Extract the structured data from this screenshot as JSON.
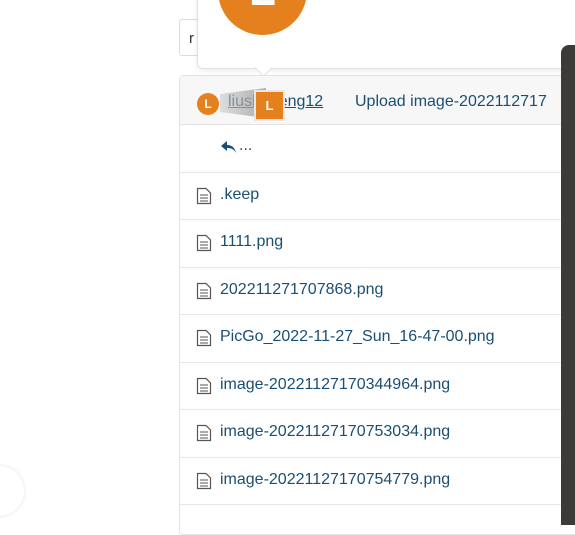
{
  "popup": {
    "avatar_letter": "L"
  },
  "search": {
    "value": "r"
  },
  "commit": {
    "avatar_letter": "L",
    "drag_avatar_letter": "L",
    "author": "liushuheng12",
    "message": "Upload image-2022112717"
  },
  "files": {
    "parent_label": "...",
    "items": [
      {
        "name": ".keep"
      },
      {
        "name": "1111.png"
      },
      {
        "name": "202211271707868.png"
      },
      {
        "name": "PicGo_2022-11-27_Sun_16-47-00.png"
      },
      {
        "name": "image-20221127170344964.png"
      },
      {
        "name": "image-20221127170753034.png"
      },
      {
        "name": "image-20221127170754779.png"
      }
    ]
  },
  "colors": {
    "accent": "#e5801e",
    "link": "#1a4f73"
  }
}
